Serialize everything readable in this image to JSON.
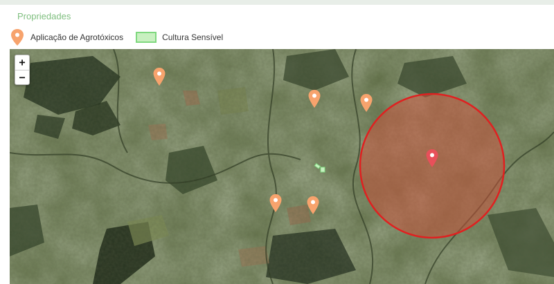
{
  "panel": {
    "title": "Propriedades"
  },
  "legend": {
    "pesticide_label": "Aplicação de Agrotóxicos",
    "sensitive_label": "Cultura Sensível",
    "pesticide_color": "#f7a36d",
    "sensitive_fill": "#c8f0c0",
    "sensitive_border": "#7fd87f"
  },
  "map": {
    "zoom_in_label": "+",
    "zoom_out_label": "−",
    "marker_color": "#f7a36d",
    "selected_marker_color": "#e8505a",
    "radius_circle": {
      "stroke": "#e02020",
      "fill": "#d0503a"
    },
    "markers": [
      {
        "type": "pesticide-application",
        "selected": false
      },
      {
        "type": "pesticide-application",
        "selected": false
      },
      {
        "type": "pesticide-application",
        "selected": false
      },
      {
        "type": "pesticide-application",
        "selected": false
      },
      {
        "type": "pesticide-application",
        "selected": false
      },
      {
        "type": "pesticide-application",
        "selected": true
      }
    ]
  }
}
